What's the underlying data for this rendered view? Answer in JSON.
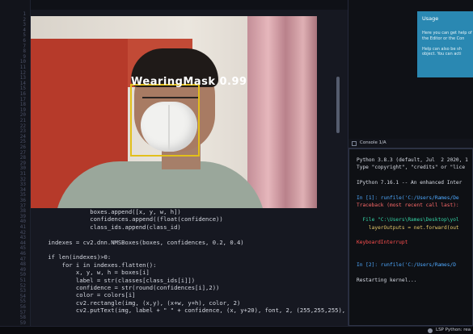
{
  "editor": {
    "title_bar": "",
    "line_numbers": [
      "1",
      "2",
      "3",
      "4",
      "5",
      "6",
      "7",
      "8",
      "9",
      "10",
      "11",
      "12",
      "13",
      "14",
      "15",
      "16",
      "17",
      "18",
      "19",
      "20",
      "21",
      "22",
      "23",
      "24",
      "25",
      "26",
      "27",
      "28",
      "29",
      "30",
      "31",
      "32",
      "33",
      "34",
      "35",
      "36",
      "37",
      "38",
      "39",
      "40",
      "41",
      "42",
      "43",
      "44",
      "45",
      "46",
      "47",
      "48",
      "49",
      "50",
      "51",
      "52",
      "53",
      "54",
      "55",
      "56",
      "57",
      "58",
      "59"
    ],
    "code_lines": [
      "                boxes.append([x, y, w, h])",
      "                confidences.append((float(confidence))",
      "                class_ids.append(class_id)",
      "",
      "    indexes = cv2.dnn.NMSBoxes(boxes, confidences, 0.2, 0.4)",
      "",
      "    if len(indexes)>0:",
      "        for i in indexes.flatten():",
      "            x, y, w, h = boxes[i]",
      "            label = str(classes[class_ids[i]])",
      "            confidence = str(round(confidences[i],2))",
      "            color = colors[i]",
      "            cv2.rectangle(img, (x,y), (x+w, y+h), color, 2)",
      "            cv2.putText(img, label + \" \" + confidence, (x, y+20), font, 2, (255,255,255), 2)"
    ]
  },
  "webcam": {
    "detection_label": "WearingMask 0.99",
    "box_color": "#e2bf1b"
  },
  "usage_panel": {
    "title": "Usage",
    "lines": [
      "Here you can get help of",
      "the Editor or the Con",
      "",
      "Help can also be sh",
      "object. You can acti"
    ]
  },
  "console": {
    "tab_label": "Console 1/A",
    "lines": [
      "Python 3.8.3 (default, Jul  2 2020, 1",
      "Type \"copyright\", \"credits\" or \"lice",
      "",
      "IPython 7.16.1 -- An enhanced Inter",
      "",
      "In [1]: runfile('C:/Users/Rames/De",
      "Traceback (most recent call last):",
      "",
      "  File \"C:\\Users\\Rames\\Desktop\\yol",
      "    layerOutputs = net.forward(out",
      "",
      "KeyboardInterrupt",
      "",
      "",
      "In [2]: runfile('C:/Users/Rames/D",
      "",
      "Restarting kernel..."
    ]
  },
  "statusbar": {
    "lsp": "LSP Python: rea"
  },
  "colors": {
    "accent_usage": "#2a88b2",
    "prompt_blue": "#4fa9ff",
    "error_red": "#ff4f4f"
  }
}
